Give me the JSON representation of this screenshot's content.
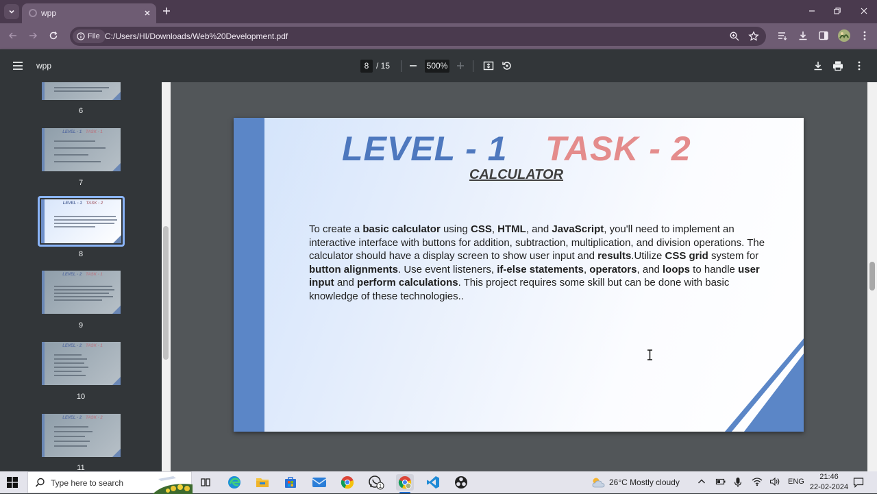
{
  "browser": {
    "tab_title": "wpp",
    "site_chip": "File",
    "url": "C:/Users/HI/Downloads/Web%20Development.pdf"
  },
  "pdf_toolbar": {
    "doc_title": "wpp",
    "current_page": "8",
    "total_pages": "/ 15",
    "zoom": "500%"
  },
  "thumbnails": [
    {
      "num": "6",
      "head_level": "",
      "head_task": ""
    },
    {
      "num": "7",
      "head_level": "LEVEL - 1",
      "head_task": "TASK - 1"
    },
    {
      "num": "8",
      "head_level": "LEVEL - 1",
      "head_task": "TASK - 2",
      "selected": true
    },
    {
      "num": "9",
      "head_level": "LEVEL - 2",
      "head_task": "TASK - 1"
    },
    {
      "num": "10",
      "head_level": "LEVEL - 2",
      "head_task": "TASK - 1"
    },
    {
      "num": "11",
      "head_level": "LEVEL - 2",
      "head_task": "TASK - 2"
    }
  ],
  "page": {
    "heading_level": "LEVEL - 1",
    "heading_task": "TASK - 2",
    "subheading": "CALCULATOR",
    "body": [
      {
        "t": "To create a "
      },
      {
        "t": "basic calculator",
        "b": true
      },
      {
        "t": " using "
      },
      {
        "t": "CSS",
        "b": true
      },
      {
        "t": ", "
      },
      {
        "t": "HTML",
        "b": true
      },
      {
        "t": ", and "
      },
      {
        "t": "JavaScript",
        "b": true
      },
      {
        "t": ", you'll need to implement an interactive interface with buttons for addition, subtraction, multiplication, and division operations. The calculator should have a display screen to show user input and "
      },
      {
        "t": "results",
        "b": true
      },
      {
        "t": ".Utilize "
      },
      {
        "t": "CSS grid",
        "b": true
      },
      {
        "t": " system for "
      },
      {
        "t": "button alignments",
        "b": true
      },
      {
        "t": ". Use event listeners, "
      },
      {
        "t": "if-else statements",
        "b": true
      },
      {
        "t": ", "
      },
      {
        "t": "operators",
        "b": true
      },
      {
        "t": ", and "
      },
      {
        "t": "loops",
        "b": true
      },
      {
        "t": " to handle "
      },
      {
        "t": "user input",
        "b": true
      },
      {
        "t": " and "
      },
      {
        "t": "perform calculations",
        "b": true
      },
      {
        "t": ". This project requires some skill but can be done with basic knowledge of these technologies.."
      }
    ]
  },
  "taskbar": {
    "search_placeholder": "Type here to search",
    "weather": "26°C  Mostly cloudy",
    "language": "ENG",
    "time": "21:46",
    "date": "22-02-2024",
    "whatsapp_badge": "1"
  },
  "colors": {
    "accent_blue": "#4e78be",
    "accent_pink": "#e48c8c",
    "browser_frame": "#6e5c73",
    "selection": "#8ab4f8"
  }
}
